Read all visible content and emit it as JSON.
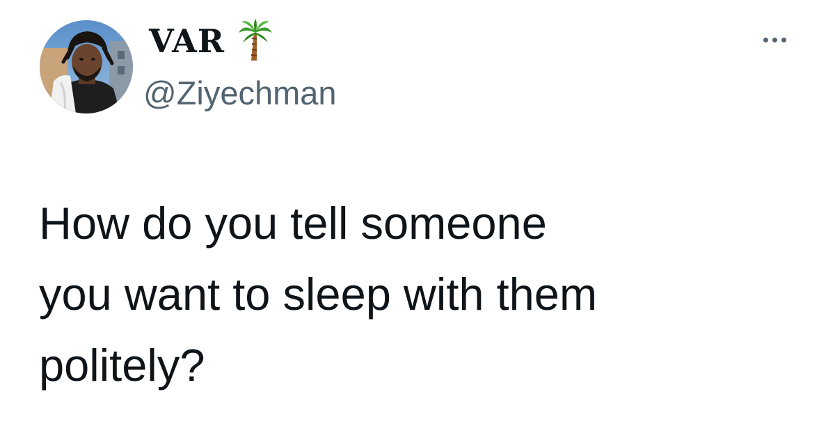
{
  "tweet": {
    "display_name": "VAR",
    "name_emoji": "palm-tree-icon",
    "handle": "@Ziyechman",
    "more_icon": "more-horizontal-icon",
    "text": "How do you tell someone\nyou want to sleep with them\npolitely?"
  },
  "colors": {
    "text_primary": "#0f1419",
    "text_secondary": "#536471",
    "background": "#ffffff"
  }
}
